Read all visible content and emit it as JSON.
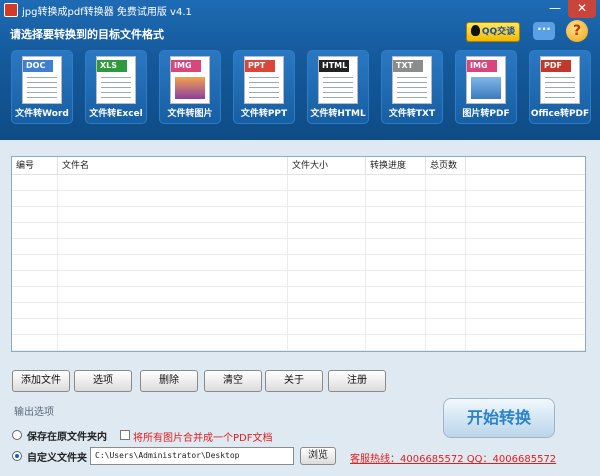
{
  "window": {
    "title": "jpg转换成pdf转换器 免费试用版 v4.1",
    "minimize_glyph": "—",
    "close_glyph": "✕"
  },
  "header": {
    "subtitle": "请选择要转换到的目标文件格式",
    "qq_chat_label": "QQ交谈",
    "message_glyph": "···",
    "help_glyph": "?"
  },
  "formats": [
    {
      "tag": "DOC",
      "label": "文件转Word",
      "color": "#3f7fcf"
    },
    {
      "tag": "XLS",
      "label": "文件转Excel",
      "color": "#2e9a3c"
    },
    {
      "tag": "IMG",
      "label": "文件转图片",
      "color": "#d9467e"
    },
    {
      "tag": "PPT",
      "label": "文件转PPT",
      "color": "#d9463a"
    },
    {
      "tag": "HTML",
      "label": "文件转HTML",
      "color": "#222222"
    },
    {
      "tag": "TXT",
      "label": "文件转TXT",
      "color": "#8c8c8c"
    },
    {
      "tag": "IMG",
      "label": "图片转PDF",
      "color": "#d9467e"
    },
    {
      "tag": "PDF",
      "label": "Office转PDF",
      "color": "#c0392b"
    }
  ],
  "table": {
    "columns": [
      "编号",
      "文件名",
      "文件大小",
      "转换进度",
      "总页数"
    ]
  },
  "actions": {
    "add_file": "添加文件",
    "options": "选项",
    "delete": "删除",
    "clear": "清空",
    "about": "关于",
    "register": "注册"
  },
  "output": {
    "title": "输出选项",
    "save_original": "保存在原文件夹内",
    "merge_images": "将所有图片合并成一个PDF文档",
    "custom_folder": "自定义文件夹",
    "path_value": "C:\\Users\\Administrator\\Desktop",
    "browse": "浏览",
    "selected": "custom"
  },
  "start_label": "开始转换",
  "hotline": "客服热线：4006685572 QQ：4006685572"
}
